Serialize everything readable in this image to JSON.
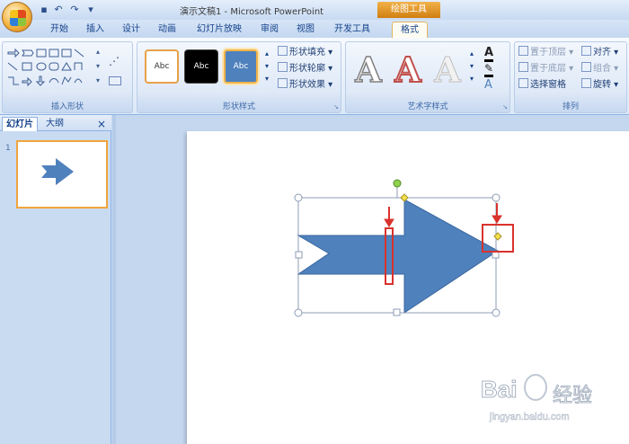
{
  "window": {
    "doc_title": "演示文稿1 - Microsoft PowerPoint",
    "contextual_label": "绘图工具"
  },
  "tabs": [
    {
      "label": "开始"
    },
    {
      "label": "插入"
    },
    {
      "label": "设计"
    },
    {
      "label": "动画"
    },
    {
      "label": "幻灯片放映"
    },
    {
      "label": "审阅"
    },
    {
      "label": "视图"
    },
    {
      "label": "开发工具"
    },
    {
      "label": "格式"
    }
  ],
  "ribbon": {
    "insert_shapes": {
      "label": "插入形状"
    },
    "shape_styles": {
      "label": "形状样式",
      "buttons": [
        {
          "label": "Abc"
        },
        {
          "label": "Abc"
        },
        {
          "label": "Abc"
        }
      ],
      "fill": "形状填充",
      "outline": "形状轮廓",
      "effects": "形状效果"
    },
    "wordart": {
      "label": "艺术字样式",
      "letters": [
        "A",
        "A",
        "A"
      ]
    },
    "arrange": {
      "label": "排列",
      "bring_front": "置于顶层",
      "send_back": "置于底层",
      "selection_pane": "选择窗格",
      "align": "对齐",
      "group": "组合",
      "rotate": "旋转"
    }
  },
  "left_pane": {
    "tab_slides": "幻灯片",
    "tab_outline": "大纲",
    "close_glyph": "×",
    "slide_number": "1"
  },
  "watermark": {
    "brand": "Bai",
    "brand_suffix": "经验",
    "url": "jingyan.baidu.com"
  },
  "colors": {
    "arrow_fill": "#4f81bd",
    "highlight_red": "#d9322c",
    "contextual_orange": "#e8962a"
  }
}
